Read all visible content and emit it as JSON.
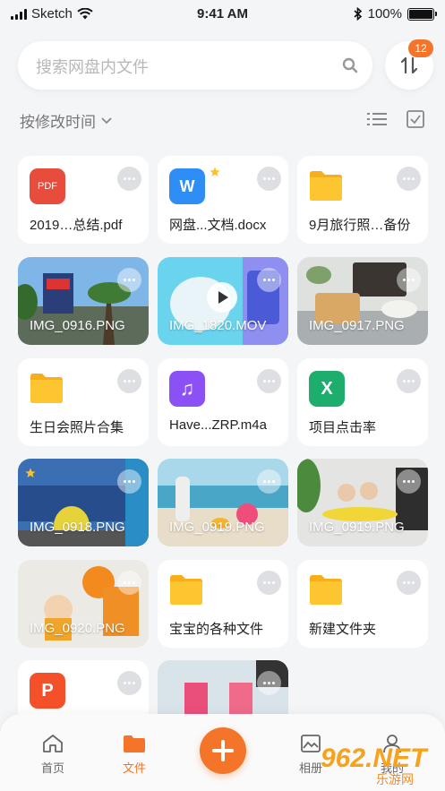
{
  "status_bar": {
    "carrier": "Sketch",
    "time": "9:41 AM",
    "battery": "100%"
  },
  "search": {
    "placeholder": "搜索网盘内文件"
  },
  "sort_badge": "12",
  "sort_label": "按修改时间",
  "colors": {
    "accent": "#f4742a",
    "pdf": "#e84c3d",
    "word": "#2f8ef5",
    "folder": "#fdc02f",
    "audio": "#8b51f5",
    "excel": "#1dae6e",
    "ppt": "#f4502a"
  },
  "files": [
    {
      "name": "2019…总结.pdf",
      "type": "pdf",
      "icon_label": "PDF"
    },
    {
      "name": "网盘...文档.docx",
      "type": "word",
      "icon_label": "W",
      "starred": true
    },
    {
      "name": "9月旅行照…备份",
      "type": "folder"
    },
    {
      "name": "IMG_0916.PNG",
      "type": "image"
    },
    {
      "name": "IMG_1820.MOV",
      "type": "video"
    },
    {
      "name": "IMG_0917.PNG",
      "type": "image"
    },
    {
      "name": "生日会照片合集",
      "type": "folder"
    },
    {
      "name": "Have...ZRP.m4a",
      "type": "audio",
      "icon_label": "♫"
    },
    {
      "name": "项目点击率",
      "type": "excel",
      "icon_label": "X"
    },
    {
      "name": "IMG_0918.PNG",
      "type": "image"
    },
    {
      "name": "IMG_0919.PNG",
      "type": "image"
    },
    {
      "name": "IMG_0919.PNG",
      "type": "image"
    },
    {
      "name": "IMG_0920.PNG",
      "type": "image"
    },
    {
      "name": "宝宝的各种文件",
      "type": "folder"
    },
    {
      "name": "新建文件夹",
      "type": "folder"
    },
    {
      "name": "",
      "type": "ppt",
      "icon_label": "P"
    },
    {
      "name": "",
      "type": "image"
    }
  ],
  "tabs": [
    {
      "label": "首页",
      "icon": "home-icon"
    },
    {
      "label": "文件",
      "icon": "folder-icon",
      "active": true
    },
    {
      "label": "相册",
      "icon": "album-icon"
    },
    {
      "label": "我的",
      "icon": "user-icon"
    }
  ],
  "watermark": {
    "logo": "962.NET",
    "sub": "乐游网"
  }
}
